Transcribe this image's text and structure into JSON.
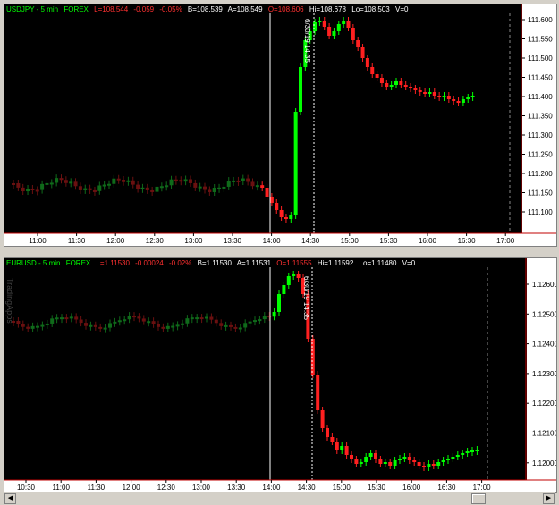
{
  "top_chart": {
    "header": {
      "symbol": "USDJPY - 5 min",
      "exchange": "FOREX",
      "last": "L=108.544",
      "change": "-0.059",
      "change_pct": "-0.05%",
      "bid": "B=108.539",
      "ask": "A=108.549",
      "open": "O=108.606",
      "high": "Hi=108.678",
      "low": "Lo=108.503",
      "volume": "V=0"
    },
    "price_labels": [
      "111.600",
      "111.550",
      "111.500",
      "111.450",
      "111.400",
      "111.350",
      "111.300",
      "111.250",
      "111.200",
      "111.150",
      "111.100"
    ],
    "time_labels": [
      "11:00",
      "11:30",
      "12:00",
      "12:30",
      "13:00",
      "13:30",
      "14:00",
      "14:30",
      "15:00",
      "15:30",
      "16:00",
      "16:30",
      "17:00"
    ],
    "annotation": "6/30/19 14:35",
    "colors": {
      "up": "#00ff00",
      "down": "#ff0000",
      "dim_up": "#0a3a0a",
      "dim_down": "#3a0a0a"
    }
  },
  "bottom_chart": {
    "header": {
      "symbol": "EURUSD - 5 min",
      "exchange": "FOREX",
      "last": "L=1.11530",
      "change": "-0.00024",
      "change_pct": "-0.02%",
      "bid": "B=1.11530",
      "ask": "A=1.11531",
      "open": "O=1.11555",
      "high": "Hi=1.11592",
      "low": "Lo=1.11480",
      "volume": "V=0"
    },
    "watermark": "TradingApps",
    "price_labels": [
      "1.12600",
      "1.12500",
      "1.12400",
      "1.12300",
      "1.12200",
      "1.12100",
      "1.12000"
    ],
    "time_labels": [
      "10:30",
      "11:00",
      "11:30",
      "12:00",
      "12:30",
      "13:00",
      "13:30",
      "14:00",
      "14:30",
      "15:00",
      "15:30",
      "16:00",
      "16:30",
      "17:00"
    ],
    "annotation": "6/30/19 14:35"
  }
}
